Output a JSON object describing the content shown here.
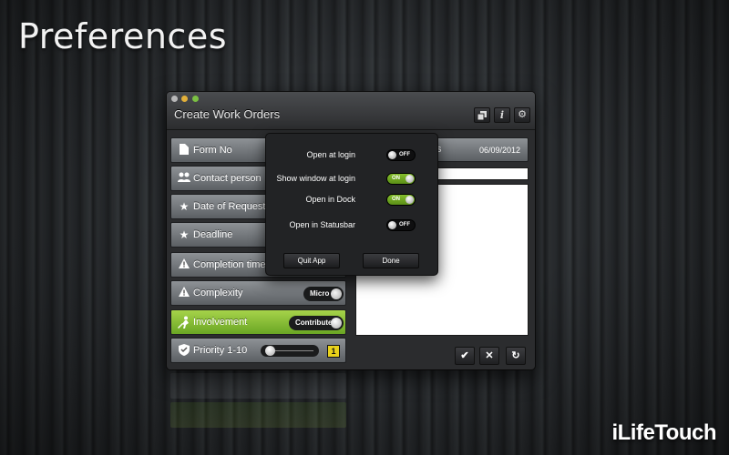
{
  "headline": "Preferences",
  "brand": "iLifeTouch",
  "window": {
    "title": "Create Work Orders",
    "toolbar": {
      "copy_icon": "copy-icon",
      "info_label": "i",
      "gear_icon": "gear-icon"
    }
  },
  "rows": [
    {
      "label": "Form No",
      "icon": "document-icon"
    },
    {
      "label": "Contact person",
      "icon": "people-icon"
    },
    {
      "label": "Date of Request",
      "icon": "star-icon"
    },
    {
      "label": "Deadline",
      "icon": "star-icon"
    },
    {
      "label": "Completion time",
      "icon": "warning-icon"
    },
    {
      "label": "Complexity",
      "icon": "warning-icon",
      "value": "Micro"
    },
    {
      "label": "Involvement",
      "icon": "worker-icon",
      "value": "Contribute",
      "active": true
    },
    {
      "label": "Priority 1-10",
      "icon": "shield-icon",
      "priority": 1
    }
  ],
  "date_bar": {
    "fragment": "s",
    "date": "06/09/2012"
  },
  "popover": {
    "settings": [
      {
        "label": "Open at login",
        "state": "OFF"
      },
      {
        "label": "Show window at login",
        "state": "ON"
      },
      {
        "label": "Open in Dock",
        "state": "ON"
      },
      {
        "label": "Open in Statusbar",
        "state": "OFF"
      }
    ],
    "quit_label": "Quit App",
    "done_label": "Done"
  },
  "actions": {
    "ok": "✔",
    "cancel": "✕",
    "refresh": "↻"
  },
  "colors": {
    "accent_green": "#8cc63f",
    "badge_yellow": "#e9d21b"
  }
}
